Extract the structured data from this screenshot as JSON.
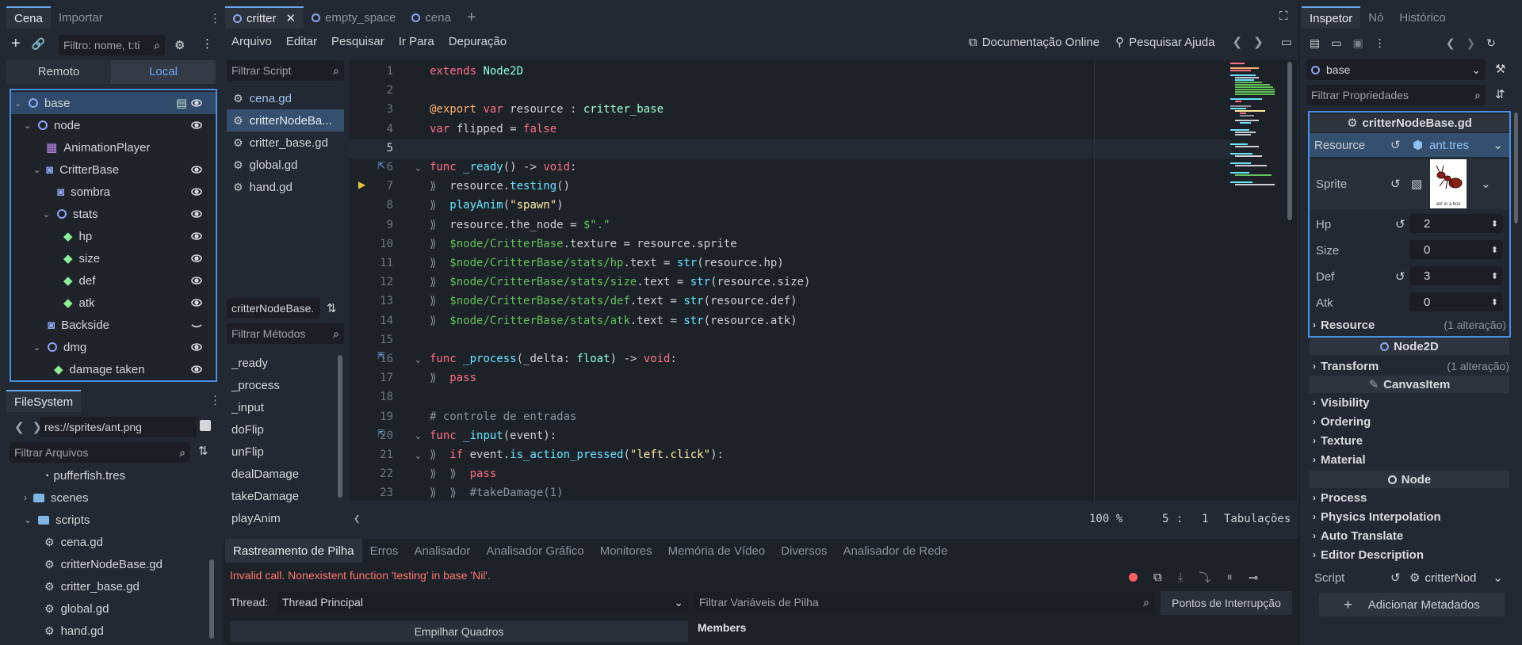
{
  "scene_dock": {
    "tabs": [
      "Cena",
      "Importar"
    ],
    "filter_placeholder": "Filtro: nome, t:ti",
    "remote_label": "Remoto",
    "local_label": "Local",
    "tree": [
      {
        "label": "base",
        "icon": "node-circle-icon",
        "eye": true,
        "script": true
      },
      {
        "label": "node",
        "icon": "node-circle-icon",
        "eye": true
      },
      {
        "label": "AnimationPlayer",
        "icon": "animation-player-icon"
      },
      {
        "label": "CritterBase",
        "icon": "sprite-icon",
        "eye": true
      },
      {
        "label": "sombra",
        "icon": "sprite-icon",
        "eye": true
      },
      {
        "label": "stats",
        "icon": "node-circle-icon",
        "eye": true
      },
      {
        "label": "hp",
        "icon": "label-icon",
        "eye": true
      },
      {
        "label": "size",
        "icon": "label-icon",
        "eye": true
      },
      {
        "label": "def",
        "icon": "label-icon",
        "eye": true
      },
      {
        "label": "atk",
        "icon": "label-icon",
        "eye": true
      },
      {
        "label": "Backside",
        "icon": "sprite-icon",
        "eye_closed": true
      },
      {
        "label": "dmg",
        "icon": "node-circle-icon",
        "eye": true
      },
      {
        "label": "damage taken",
        "icon": "label-icon",
        "eye": true
      }
    ]
  },
  "filesystem": {
    "tab": "FileSystem",
    "path": "res://sprites/ant.png",
    "filter_placeholder": "Filtrar Arquivos",
    "items": [
      {
        "label": "pufferfish.tres"
      },
      {
        "label": "scenes"
      },
      {
        "label": "scripts"
      },
      {
        "label": "cena.gd"
      },
      {
        "label": "critterNodeBase.gd"
      },
      {
        "label": "critter_base.gd"
      },
      {
        "label": "global.gd"
      },
      {
        "label": "hand.gd"
      }
    ]
  },
  "editor_tabs": [
    "critter",
    "empty_space",
    "cena"
  ],
  "script_menu": {
    "items": [
      "Arquivo",
      "Editar",
      "Pesquisar",
      "Ir Para",
      "Depuração"
    ],
    "online_docs": "Documentação Online",
    "search_help": "Pesquisar Ajuda"
  },
  "script_list": {
    "filter_placeholder": "Filtrar Script",
    "scripts": [
      "cena.gd",
      "critterNodeBa...",
      "critter_base.gd",
      "global.gd",
      "hand.gd"
    ],
    "current_script": "critterNodeBase.",
    "methods_filter_placeholder": "Filtrar Métodos",
    "methods": [
      "_ready",
      "_process",
      "_input",
      "doFlip",
      "unFlip",
      "dealDamage",
      "takeDamage",
      "playAnim"
    ]
  },
  "code": {
    "lines": [
      {
        "n": "1",
        "tokens": [
          [
            "kw",
            "extends "
          ],
          [
            "ty",
            "Node2D"
          ]
        ]
      },
      {
        "n": "2",
        "tokens": []
      },
      {
        "n": "3",
        "tokens": [
          [
            "ann",
            "@export "
          ],
          [
            "kw",
            "var "
          ],
          [
            "df",
            "resource : "
          ],
          [
            "nm",
            "critter_base"
          ]
        ]
      },
      {
        "n": "4",
        "tokens": [
          [
            "kw",
            "var "
          ],
          [
            "df",
            "flipped = "
          ],
          [
            "kw",
            "false"
          ]
        ]
      },
      {
        "n": "5",
        "tokens": []
      },
      {
        "n": "6",
        "tokens": [
          [
            "kw",
            "func "
          ],
          [
            "fn",
            "_ready"
          ],
          [
            "df",
            "() -> "
          ],
          [
            "kw",
            "void"
          ],
          [
            "df",
            ":"
          ]
        ]
      },
      {
        "n": "7",
        "tokens": [
          [
            "cm",
            "⟫  "
          ],
          [
            "df",
            "resource."
          ],
          [
            "fn",
            "testing"
          ],
          [
            "df",
            "()"
          ]
        ]
      },
      {
        "n": "8",
        "tokens": [
          [
            "cm",
            "⟫  "
          ],
          [
            "fn",
            "playAnim"
          ],
          [
            "df",
            "("
          ],
          [
            "str",
            "\"spawn\""
          ],
          [
            "df",
            ")"
          ]
        ]
      },
      {
        "n": "9",
        "tokens": [
          [
            "cm",
            "⟫  "
          ],
          [
            "df",
            "resource.the_node = "
          ],
          [
            "np",
            "$\".\""
          ]
        ]
      },
      {
        "n": "10",
        "tokens": [
          [
            "cm",
            "⟫  "
          ],
          [
            "np",
            "$node/CritterBase"
          ],
          [
            "df",
            ".texture = resource.sprite"
          ]
        ]
      },
      {
        "n": "11",
        "tokens": [
          [
            "cm",
            "⟫  "
          ],
          [
            "np",
            "$node/CritterBase/stats/hp"
          ],
          [
            "df",
            ".text = "
          ],
          [
            "fn",
            "str"
          ],
          [
            "df",
            "(resource.hp)"
          ]
        ]
      },
      {
        "n": "12",
        "tokens": [
          [
            "cm",
            "⟫  "
          ],
          [
            "np",
            "$node/CritterBase/stats/size"
          ],
          [
            "df",
            ".text = "
          ],
          [
            "fn",
            "str"
          ],
          [
            "df",
            "(resource.size)"
          ]
        ]
      },
      {
        "n": "13",
        "tokens": [
          [
            "cm",
            "⟫  "
          ],
          [
            "np",
            "$node/CritterBase/stats/def"
          ],
          [
            "df",
            ".text = "
          ],
          [
            "fn",
            "str"
          ],
          [
            "df",
            "(resource.def)"
          ]
        ]
      },
      {
        "n": "14",
        "tokens": [
          [
            "cm",
            "⟫  "
          ],
          [
            "np",
            "$node/CritterBase/stats/atk"
          ],
          [
            "df",
            ".text = "
          ],
          [
            "fn",
            "str"
          ],
          [
            "df",
            "(resource.atk)"
          ]
        ]
      },
      {
        "n": "15",
        "tokens": []
      },
      {
        "n": "16",
        "tokens": [
          [
            "kw",
            "func "
          ],
          [
            "fn",
            "_process"
          ],
          [
            "df",
            "(_delta: "
          ],
          [
            "ty",
            "float"
          ],
          [
            "df",
            ") -> "
          ],
          [
            "kw",
            "void"
          ],
          [
            "df",
            ":"
          ]
        ]
      },
      {
        "n": "17",
        "tokens": [
          [
            "cm",
            "⟫  "
          ],
          [
            "kw",
            "pass"
          ]
        ]
      },
      {
        "n": "18",
        "tokens": []
      },
      {
        "n": "19",
        "tokens": [
          [
            "cm",
            "# controle de entradas"
          ]
        ]
      },
      {
        "n": "20",
        "tokens": [
          [
            "kw",
            "func "
          ],
          [
            "fn",
            "_input"
          ],
          [
            "df",
            "(event):"
          ]
        ]
      },
      {
        "n": "21",
        "tokens": [
          [
            "cm",
            "⟫  "
          ],
          [
            "kw",
            "if "
          ],
          [
            "df",
            "event."
          ],
          [
            "fn",
            "is_action_pressed"
          ],
          [
            "df",
            "("
          ],
          [
            "str",
            "\"left.click\""
          ],
          [
            "df",
            "):"
          ]
        ]
      },
      {
        "n": "22",
        "tokens": [
          [
            "cm",
            "⟫  ⟫  "
          ],
          [
            "kw",
            "pass"
          ]
        ]
      },
      {
        "n": "23",
        "tokens": [
          [
            "cm",
            "⟫  ⟫  #takeDamage(1)"
          ]
        ]
      }
    ]
  },
  "status_bar": {
    "zoom": "100 %",
    "line": "5",
    "col": "1",
    "indent": "Tabulações"
  },
  "bottom": {
    "tabs": [
      "Rastreamento de Pilha",
      "Erros",
      "Analisador",
      "Analisador Gráfico",
      "Monitores",
      "Memória de Vídeo",
      "Diversos",
      "Analisador de Rede"
    ],
    "error": "Invalid call. Nonexistent function 'testing' in base 'Nil'.",
    "thread_label": "Thread:",
    "thread_value": "Thread Principal",
    "stack_vars_placeholder": "Filtrar Variáveis de Pilha",
    "breakpoints": "Pontos de Interrupção",
    "stack_frames": "Empilhar Quadros",
    "members": "Members"
  },
  "inspector": {
    "tabs": [
      "Inspetor",
      "Nó",
      "Histórico"
    ],
    "object": "base",
    "filter_placeholder": "Filtrar Propriedades",
    "script_header": "critterNodeBase.gd",
    "resource_label": "Resource",
    "resource_value": "ant.tres",
    "sprite_label": "Sprite",
    "sprite_caption": "ant in a box",
    "props": [
      {
        "label": "Hp",
        "value": "2",
        "revert": true
      },
      {
        "label": "Size",
        "value": "0",
        "revert": false
      },
      {
        "label": "Def",
        "value": "3",
        "revert": true
      },
      {
        "label": "Atk",
        "value": "0",
        "revert": false
      }
    ],
    "resource_group": "Resource",
    "resource_changes": "(1 alteração)",
    "node2d": "Node2D",
    "transform": "Transform",
    "transform_changes": "(1 alteração)",
    "canvasitem": "CanvasItem",
    "canvas_groups": [
      "Visibility",
      "Ordering",
      "Texture",
      "Material"
    ],
    "node": "Node",
    "node_groups": [
      "Process",
      "Physics Interpolation",
      "Auto Translate",
      "Editor Description"
    ],
    "script_label": "Script",
    "script_value": "critterNod",
    "add_metadata": "Adicionar Metadados"
  },
  "colors": {
    "accent": "#6aa5f0",
    "error": "#ff786b",
    "bg": "#1d2229",
    "panel": "#232932"
  }
}
